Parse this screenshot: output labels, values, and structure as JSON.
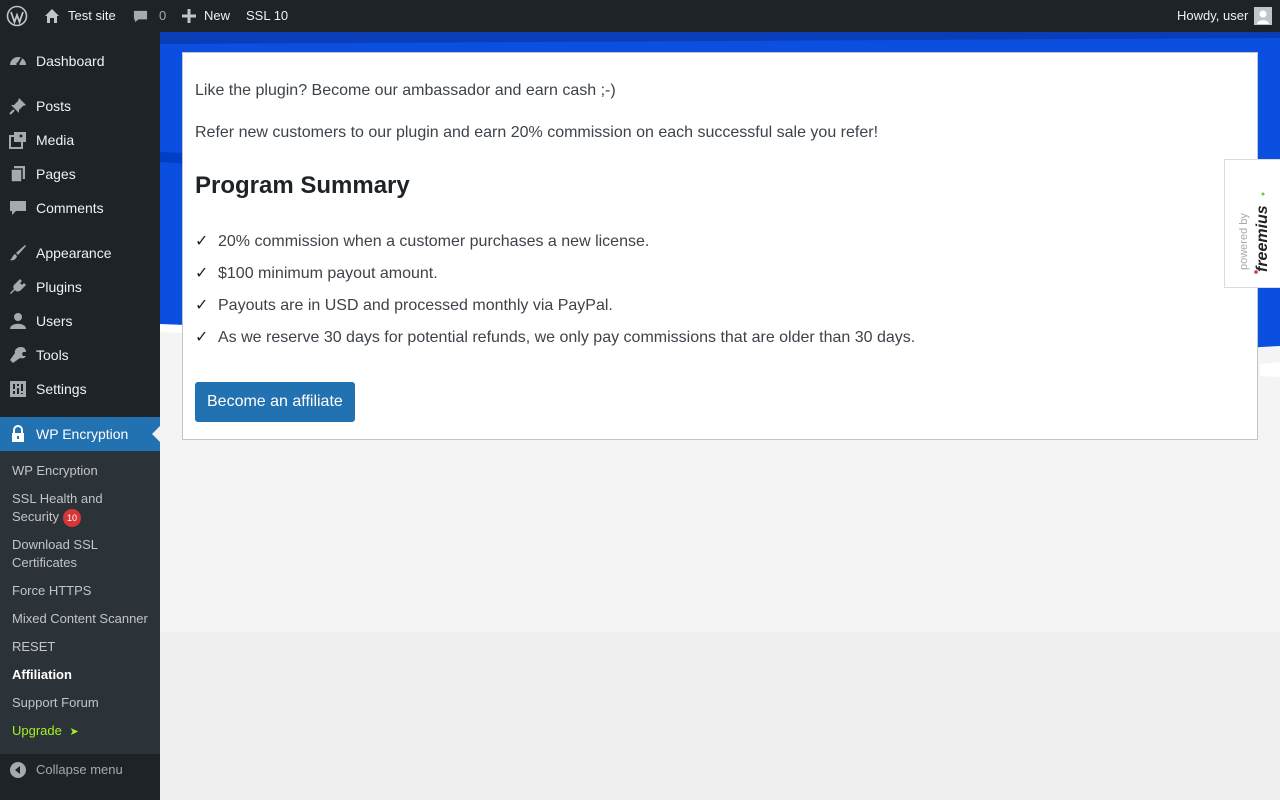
{
  "admin_bar": {
    "site_name": "Test site",
    "comments_count": "0",
    "new_label": "New",
    "ssl_label": "SSL 10",
    "greeting": "Howdy, user"
  },
  "menu": {
    "items": [
      {
        "label": "Dashboard",
        "icon": "dashboard-icon"
      },
      {
        "label": "Posts",
        "icon": "pushpin-icon"
      },
      {
        "label": "Media",
        "icon": "media-icon"
      },
      {
        "label": "Pages",
        "icon": "pages-icon"
      },
      {
        "label": "Comments",
        "icon": "comment-icon"
      },
      {
        "label": "Appearance",
        "icon": "paintbrush-icon"
      },
      {
        "label": "Plugins",
        "icon": "plug-icon"
      },
      {
        "label": "Users",
        "icon": "user-icon"
      },
      {
        "label": "Tools",
        "icon": "wrench-icon"
      },
      {
        "label": "Settings",
        "icon": "settings-icon"
      },
      {
        "label": "WP Encryption",
        "icon": "lock-icon"
      }
    ],
    "submenu": [
      {
        "label": "WP Encryption"
      },
      {
        "label": "SSL Health and Security",
        "badge": "10"
      },
      {
        "label": "Download SSL Certificates"
      },
      {
        "label": "Force HTTPS"
      },
      {
        "label": "Mixed Content Scanner"
      },
      {
        "label": "RESET"
      },
      {
        "label": "Affiliation"
      },
      {
        "label": "Support Forum"
      },
      {
        "label": "Upgrade",
        "suffix": "➤"
      }
    ],
    "collapse_label": "Collapse menu"
  },
  "affiliate": {
    "intro": "Like the plugin? Become our ambassador and earn cash ;-)",
    "refer": "Refer new customers to our plugin and earn 20% commission on each successful sale you refer!",
    "summary_title": "Program Summary",
    "check_mark": "✓",
    "summary_items": [
      "20% commission when a customer purchases a new license.",
      "$100 minimum payout amount.",
      "Payouts are in USD and processed monthly via PayPal.",
      "As we reserve 30 days for potential refunds, we only pay commissions that are older than 30 days."
    ],
    "button_label": "Become an affiliate"
  },
  "freemius": {
    "powered_by": "powered by",
    "brand": "freemius"
  },
  "colors": {
    "accent": "#2271b1",
    "banner_blue": "#0a4fe0",
    "badge_red": "#d63638",
    "upgrade_green": "#a4f125"
  }
}
